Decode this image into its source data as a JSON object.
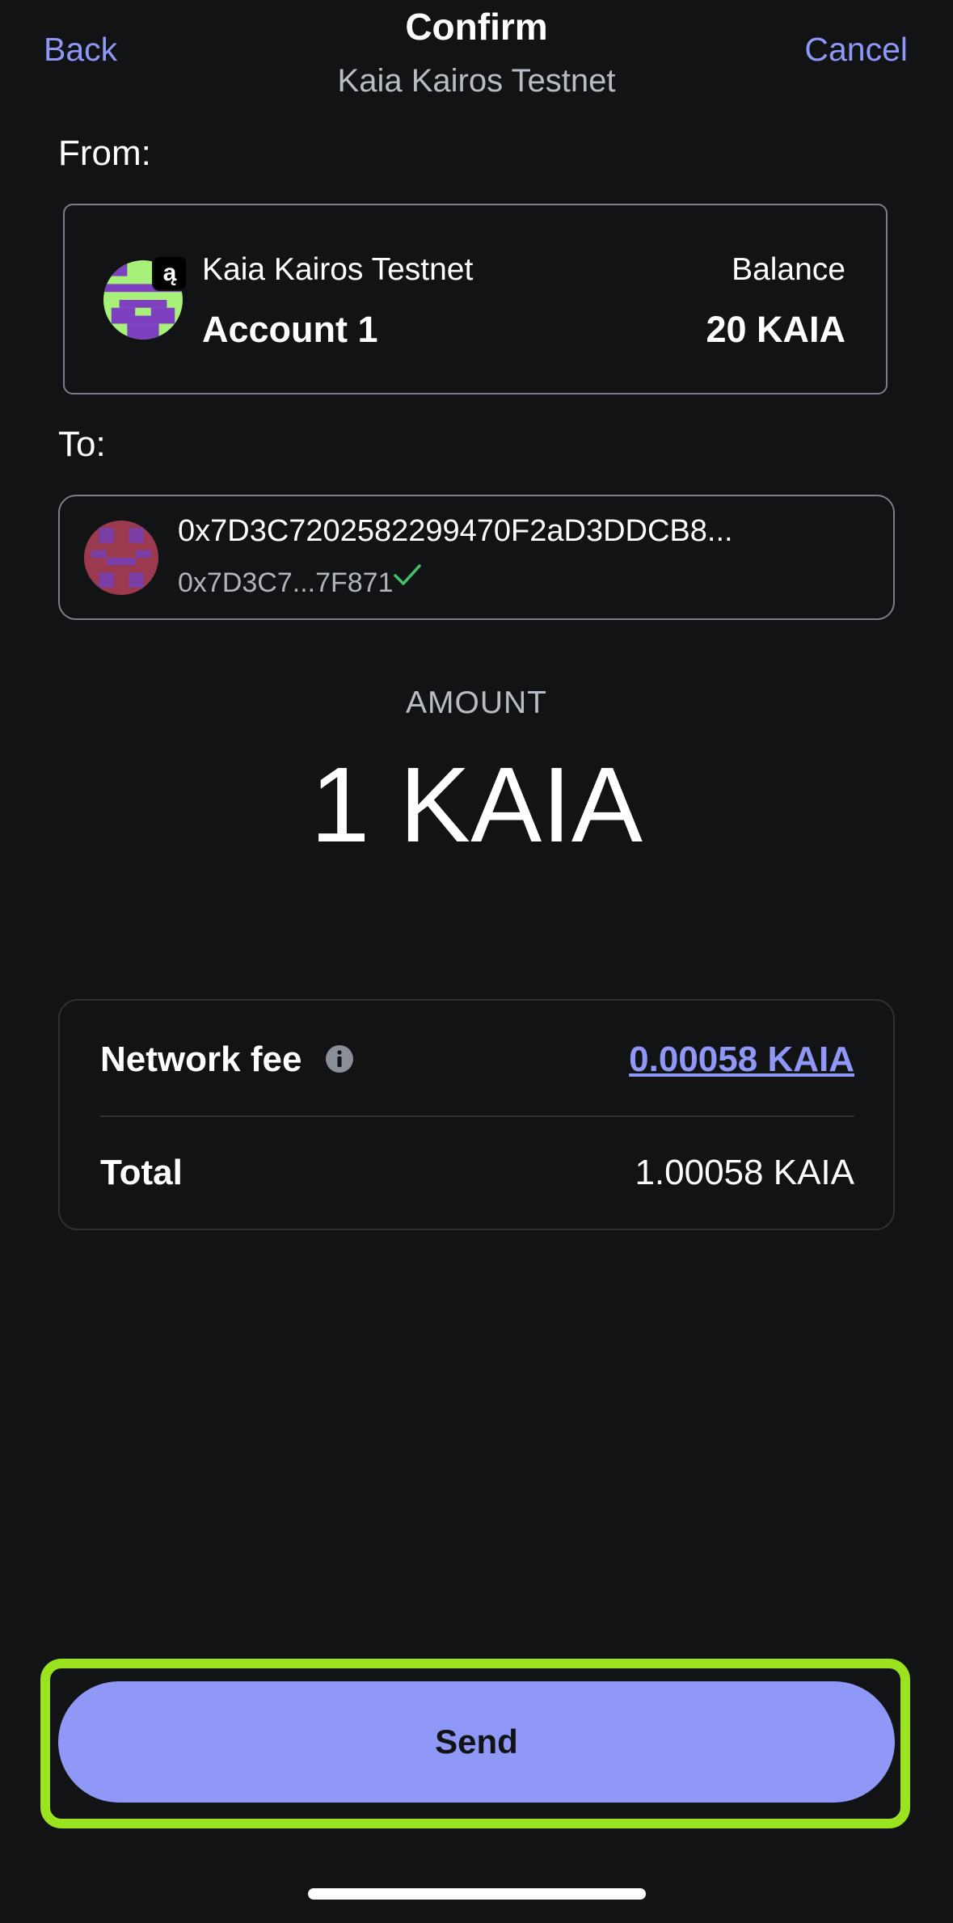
{
  "header": {
    "back_label": "Back",
    "cancel_label": "Cancel",
    "title": "Confirm",
    "subtitle": "Kaia Kairos Testnet"
  },
  "from": {
    "label": "From:",
    "network": "Kaia Kairos Testnet",
    "account": "Account 1",
    "balance_label": "Balance",
    "balance_value": "20 KAIA",
    "badge_glyph": "ą"
  },
  "to": {
    "label": "To:",
    "address": "0x7D3C7202582299470F2aD3DDCB8...",
    "short_address": "0x7D3C7...7F871"
  },
  "amount": {
    "label": "AMOUNT",
    "value": "1 KAIA"
  },
  "fee": {
    "network_fee_label": "Network fee",
    "network_fee_value": "0.00058 KAIA",
    "total_label": "Total",
    "total_value": "1.00058 KAIA"
  },
  "send_label": "Send",
  "colors": {
    "background": "#121315",
    "accent": "#8f98f7",
    "highlight": "#9be21f",
    "check": "#3fc56a"
  },
  "icons": [
    "account-avatar-icon",
    "network-badge-icon",
    "recipient-avatar-icon",
    "verified-check-icon",
    "info-icon"
  ]
}
